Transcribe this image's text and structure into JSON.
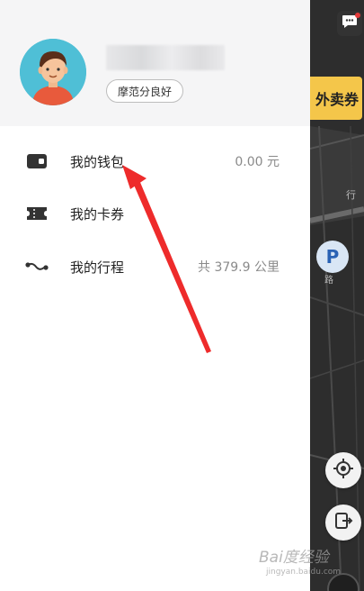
{
  "profile": {
    "credit_badge": "摩范分良好"
  },
  "menu": [
    {
      "label": "我的钱包",
      "value": "0.00 元",
      "icon": "wallet-icon"
    },
    {
      "label": "我的卡券",
      "value": "",
      "icon": "ticket-icon"
    },
    {
      "label": "我的行程",
      "value": "共 379.9 公里",
      "icon": "route-icon"
    }
  ],
  "map": {
    "promo_text": "外卖券",
    "label_road": "行",
    "label_road2": "路",
    "parking_label": "P",
    "icons": [
      "message-icon",
      "locate-icon",
      "unlock-icon"
    ]
  },
  "watermark": {
    "main": "Bai度经验",
    "sub": "jingyan.baidu.com"
  },
  "colors": {
    "accent_yellow": "#f4c64a",
    "annotation_red": "#ee2b2b",
    "map_dark": "#2b2b2b",
    "profile_bg": "#f5f5f6"
  }
}
